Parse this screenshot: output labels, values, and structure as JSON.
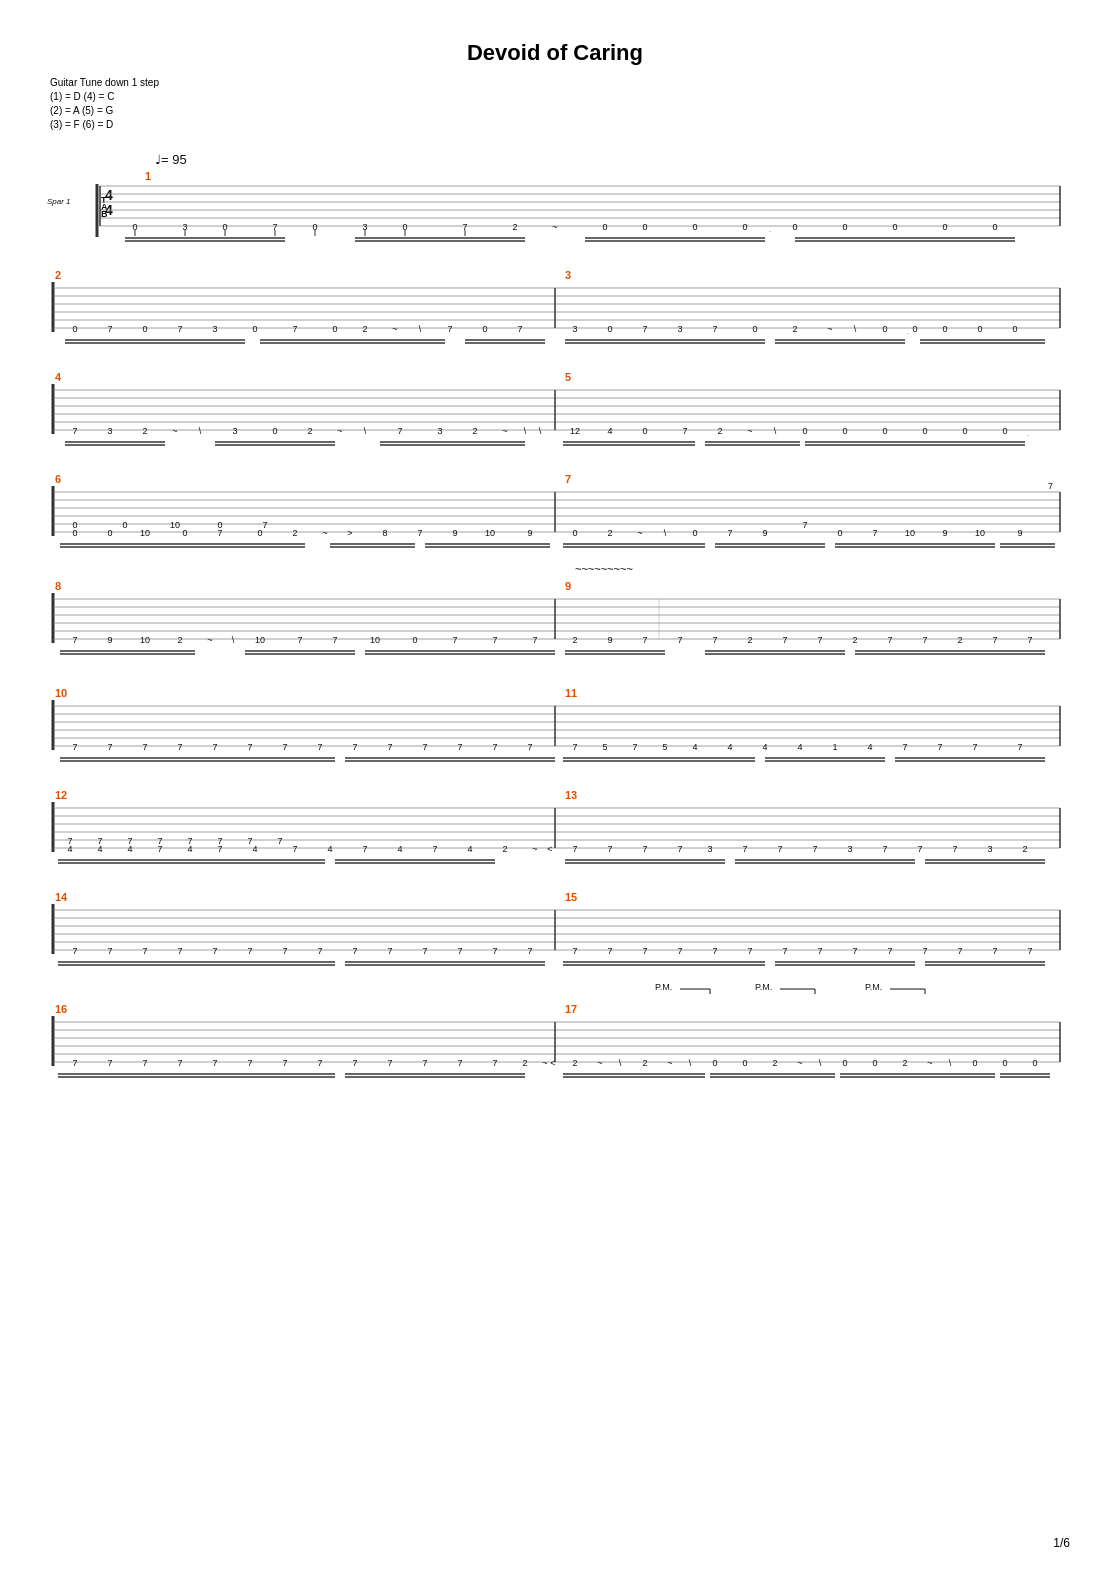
{
  "title": "Devoid of Caring",
  "tuning": {
    "label": "Guitar Tune down 1 step",
    "lines": [
      "(1) = D (4) = C",
      "(2) = A (5) = G",
      "(3) = F  (6) = D"
    ]
  },
  "tempo": {
    "value": "= 95"
  },
  "page_number": "1/6",
  "systems": [
    {
      "measures": [
        "1"
      ],
      "label": "Spar 1"
    },
    {
      "measures": [
        "2",
        "3"
      ],
      "label": ""
    },
    {
      "measures": [
        "4",
        "5"
      ],
      "label": ""
    },
    {
      "measures": [
        "6",
        "7"
      ],
      "label": ""
    },
    {
      "measures": [
        "8",
        "9"
      ],
      "label": ""
    },
    {
      "measures": [
        "10",
        "11"
      ],
      "label": ""
    },
    {
      "measures": [
        "12",
        "13"
      ],
      "label": ""
    },
    {
      "measures": [
        "14",
        "15"
      ],
      "label": ""
    },
    {
      "measures": [
        "16",
        "17"
      ],
      "label": ""
    }
  ]
}
